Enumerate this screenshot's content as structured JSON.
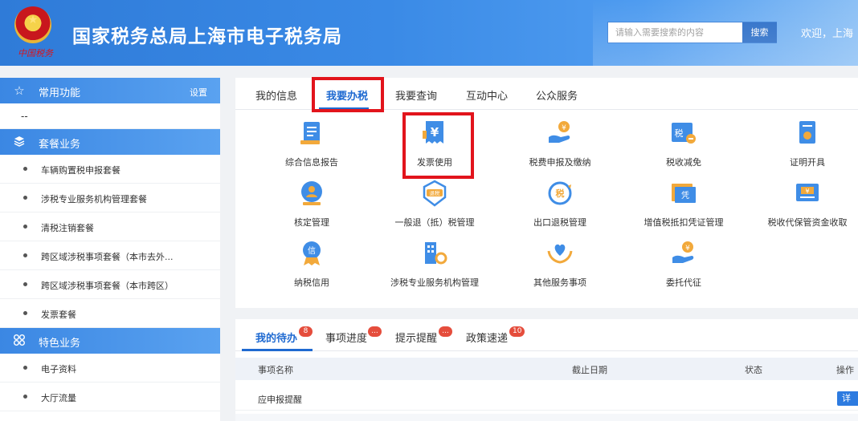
{
  "header": {
    "title": "国家税务总局上海市电子税务局",
    "emblem_script": "中国税务",
    "search_placeholder": "请输入需要搜索的内容",
    "search_button": "搜索",
    "welcome": "欢迎，上海"
  },
  "sidebar": {
    "sections": [
      {
        "label": "常用功能",
        "icon": "star-icon",
        "right": "设置"
      },
      {
        "label": "套餐业务",
        "icon": "layers-icon"
      },
      {
        "label": "特色业务",
        "icon": "grid-icon"
      }
    ],
    "common_placeholder": "--",
    "package_items": [
      "车辆购置税申报套餐",
      "涉税专业服务机构管理套餐",
      "清税注销套餐",
      "跨区域涉税事项套餐（本市去外...",
      "跨区域涉税事项套餐（本市跨区）",
      "发票套餐"
    ],
    "special_items": [
      "电子资料",
      "大厅流量"
    ]
  },
  "main": {
    "tabs": [
      "我的信息",
      "我要办税",
      "我要查询",
      "互动中心",
      "公众服务"
    ],
    "active_tab": "我要办税",
    "functions": [
      {
        "label": "综合信息报告",
        "icon": "report-icon"
      },
      {
        "label": "发票使用",
        "icon": "invoice-yen-icon"
      },
      {
        "label": "税费申报及缴纳",
        "icon": "hand-coin-icon"
      },
      {
        "label": "税收减免",
        "icon": "tax-reduction-icon"
      },
      {
        "label": "证明开具",
        "icon": "certificate-icon"
      },
      {
        "label": "核定管理",
        "icon": "person-badge-icon"
      },
      {
        "label": "一般退（抵）税管理",
        "icon": "tax-refund-shield-icon"
      },
      {
        "label": "出口退税管理",
        "icon": "tax-circle-icon"
      },
      {
        "label": "增值税抵扣凭证管理",
        "icon": "voucher-icon"
      },
      {
        "label": "税收代保管资金收取",
        "icon": "yen-card-icon"
      },
      {
        "label": "纳税信用",
        "icon": "credit-medal-icon"
      },
      {
        "label": "涉税专业服务机构管理",
        "icon": "building-gear-icon"
      },
      {
        "label": "其他服务事项",
        "icon": "heart-hands-icon"
      },
      {
        "label": "委托代征",
        "icon": "hand-coin-icon"
      }
    ],
    "function_icon_labels": {
      "tax": "税",
      "refund": "退税",
      "voucher": "凭",
      "credit": "信"
    }
  },
  "todo": {
    "tabs": [
      {
        "label": "我的待办",
        "badge": "8"
      },
      {
        "label": "事项进度",
        "badge": "..."
      },
      {
        "label": "提示提醒",
        "badge": "..."
      },
      {
        "label": "政策速递",
        "badge": "10"
      }
    ],
    "columns": [
      "事项名称",
      "截止日期",
      "状态",
      "操作"
    ],
    "rows": [
      {
        "name": "应申报提醒",
        "action": "详"
      }
    ]
  },
  "colors": {
    "primary": "#1f6ad1",
    "highlight": "#e2141c",
    "sidebar_head": "#3b87e3",
    "badge": "#e54d3c"
  }
}
